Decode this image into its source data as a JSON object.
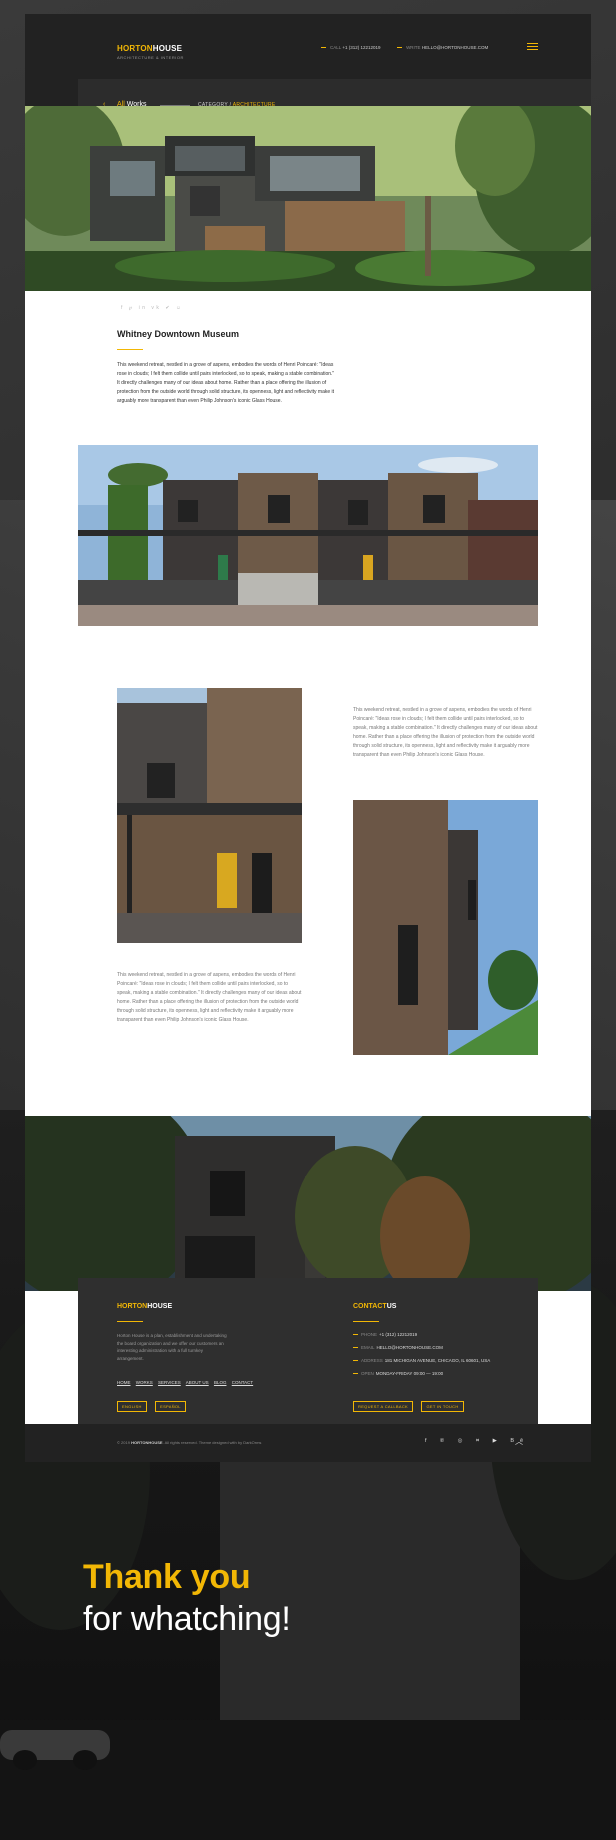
{
  "brand": {
    "name_accent": "HORTON",
    "name_rest": "HOUSE",
    "tagline": "ARCHITECTURE & INTERIOR"
  },
  "header": {
    "call_label": "CALL",
    "phone": "+1 (312) 12212019",
    "write_label": "WRITE",
    "email": "HELLO@HORTONHOUSE.COM",
    "menu_icon": "hamburger-icon"
  },
  "breadcrumb": {
    "back_arrow": "‹",
    "all_accent": "All",
    "all_rest": "Works",
    "category_label": "CATEGORY",
    "category_sep": "/",
    "category_value": "ARCHITECTURE"
  },
  "share_icons": "f  ℘  in  vk  ✔  ☺",
  "project": {
    "title": "Whitney Downtown Museum",
    "intro": "This weekend retreat, nestled in a grove of aspens, embodies the words of Henri Poincaré: \"Ideas rose in clouds; I felt them collide until pairs interlocked, so to speak, making a stable combination.\" It directly challenges many of our ideas about home. Rather than a place offering the illusion of protection from the outside world through solid structure, its openness, light and reflectivity make it arguably more transparent than even Philip Johnson's iconic Glass House.",
    "para_right": "This weekend retreat, nestled in a grove of aspens, embodies the words of Henri Poincaré: \"Ideas rose in clouds; I felt them collide until pairs interlocked, so to speak, making a stable combination.\" It directly challenges many of our ideas about home. Rather than a place offering the illusion of protection from the outside world through solid structure, its openness, light and reflectivity make it arguably more transparent than even Philip Johnson's iconic Glass House.",
    "para_left": "This weekend retreat, nestled in a grove of aspens, embodies the words of Henri Poincaré: \"Ideas rose in clouds; I felt them collide until pairs interlocked, so to speak, making a stable combination.\" It directly challenges many of our ideas about home. Rather than a place offering the illusion of protection from the outside world through solid structure, its openness, light and reflectivity make it arguably more transparent than even Philip Johnson's iconic Glass House."
  },
  "footer": {
    "logo_accent": "HORTON",
    "logo_rest": "HOUSE",
    "description": "Horton House is a plan, establishment and undertaking the board organization and we offer our customers an interesting administration with a full turnkey arrangement.",
    "nav": [
      "HOME",
      "WORKS",
      "SERVICES",
      "ABOUT US",
      "BLOG",
      "CONTACT"
    ],
    "languages": [
      "ENGLISH",
      "ESPAÑOL"
    ],
    "contact_accent": "CONTACT",
    "contact_rest": "US",
    "contacts": [
      {
        "label": "PHONE",
        "value": "+1 (312) 12212019"
      },
      {
        "label": "EMAIL",
        "value": "HELLO@HORTONHOUSE.COM"
      },
      {
        "label": "ADDRESS",
        "value": "181 MICHIGAN AVENUE, CHICAGO, IL 60601, USA"
      },
      {
        "label": "OPEN",
        "value": "MONDAY-FRIDAY 09:00 — 19:00"
      }
    ],
    "buttons": [
      "REQUEST A CALLBACK",
      "GET IN TOUCH"
    ],
    "copyright_prefix": "© 2019",
    "copyright_brand": "HORTONHOUSE",
    "copyright_suffix": ". All rights reserved. Theme designed with by DarkOrms",
    "social_icons": "f  ℗  ◎  ⌗  ▶  Bē",
    "to_top": "︿"
  },
  "thanks": {
    "line1": "Thank you",
    "line2": "for whatching!"
  },
  "colors": {
    "accent": "#f2b705",
    "dark": "#222222",
    "panel": "#2f2f2f"
  }
}
